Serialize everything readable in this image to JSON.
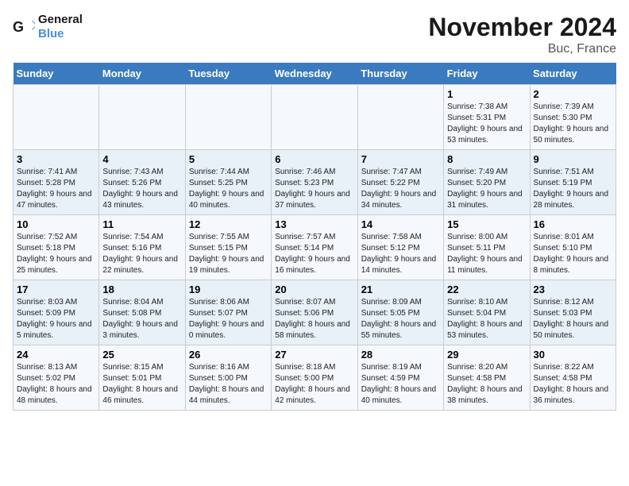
{
  "logo": {
    "text_general": "General",
    "text_blue": "Blue"
  },
  "header": {
    "month": "November 2024",
    "location": "Buc, France"
  },
  "days_of_week": [
    "Sunday",
    "Monday",
    "Tuesday",
    "Wednesday",
    "Thursday",
    "Friday",
    "Saturday"
  ],
  "weeks": [
    [
      {
        "day": "",
        "detail": ""
      },
      {
        "day": "",
        "detail": ""
      },
      {
        "day": "",
        "detail": ""
      },
      {
        "day": "",
        "detail": ""
      },
      {
        "day": "",
        "detail": ""
      },
      {
        "day": "1",
        "detail": "Sunrise: 7:38 AM\nSunset: 5:31 PM\nDaylight: 9 hours and 53 minutes."
      },
      {
        "day": "2",
        "detail": "Sunrise: 7:39 AM\nSunset: 5:30 PM\nDaylight: 9 hours and 50 minutes."
      }
    ],
    [
      {
        "day": "3",
        "detail": "Sunrise: 7:41 AM\nSunset: 5:28 PM\nDaylight: 9 hours and 47 minutes."
      },
      {
        "day": "4",
        "detail": "Sunrise: 7:43 AM\nSunset: 5:26 PM\nDaylight: 9 hours and 43 minutes."
      },
      {
        "day": "5",
        "detail": "Sunrise: 7:44 AM\nSunset: 5:25 PM\nDaylight: 9 hours and 40 minutes."
      },
      {
        "day": "6",
        "detail": "Sunrise: 7:46 AM\nSunset: 5:23 PM\nDaylight: 9 hours and 37 minutes."
      },
      {
        "day": "7",
        "detail": "Sunrise: 7:47 AM\nSunset: 5:22 PM\nDaylight: 9 hours and 34 minutes."
      },
      {
        "day": "8",
        "detail": "Sunrise: 7:49 AM\nSunset: 5:20 PM\nDaylight: 9 hours and 31 minutes."
      },
      {
        "day": "9",
        "detail": "Sunrise: 7:51 AM\nSunset: 5:19 PM\nDaylight: 9 hours and 28 minutes."
      }
    ],
    [
      {
        "day": "10",
        "detail": "Sunrise: 7:52 AM\nSunset: 5:18 PM\nDaylight: 9 hours and 25 minutes."
      },
      {
        "day": "11",
        "detail": "Sunrise: 7:54 AM\nSunset: 5:16 PM\nDaylight: 9 hours and 22 minutes."
      },
      {
        "day": "12",
        "detail": "Sunrise: 7:55 AM\nSunset: 5:15 PM\nDaylight: 9 hours and 19 minutes."
      },
      {
        "day": "13",
        "detail": "Sunrise: 7:57 AM\nSunset: 5:14 PM\nDaylight: 9 hours and 16 minutes."
      },
      {
        "day": "14",
        "detail": "Sunrise: 7:58 AM\nSunset: 5:12 PM\nDaylight: 9 hours and 14 minutes."
      },
      {
        "day": "15",
        "detail": "Sunrise: 8:00 AM\nSunset: 5:11 PM\nDaylight: 9 hours and 11 minutes."
      },
      {
        "day": "16",
        "detail": "Sunrise: 8:01 AM\nSunset: 5:10 PM\nDaylight: 9 hours and 8 minutes."
      }
    ],
    [
      {
        "day": "17",
        "detail": "Sunrise: 8:03 AM\nSunset: 5:09 PM\nDaylight: 9 hours and 5 minutes."
      },
      {
        "day": "18",
        "detail": "Sunrise: 8:04 AM\nSunset: 5:08 PM\nDaylight: 9 hours and 3 minutes."
      },
      {
        "day": "19",
        "detail": "Sunrise: 8:06 AM\nSunset: 5:07 PM\nDaylight: 9 hours and 0 minutes."
      },
      {
        "day": "20",
        "detail": "Sunrise: 8:07 AM\nSunset: 5:06 PM\nDaylight: 8 hours and 58 minutes."
      },
      {
        "day": "21",
        "detail": "Sunrise: 8:09 AM\nSunset: 5:05 PM\nDaylight: 8 hours and 55 minutes."
      },
      {
        "day": "22",
        "detail": "Sunrise: 8:10 AM\nSunset: 5:04 PM\nDaylight: 8 hours and 53 minutes."
      },
      {
        "day": "23",
        "detail": "Sunrise: 8:12 AM\nSunset: 5:03 PM\nDaylight: 8 hours and 50 minutes."
      }
    ],
    [
      {
        "day": "24",
        "detail": "Sunrise: 8:13 AM\nSunset: 5:02 PM\nDaylight: 8 hours and 48 minutes."
      },
      {
        "day": "25",
        "detail": "Sunrise: 8:15 AM\nSunset: 5:01 PM\nDaylight: 8 hours and 46 minutes."
      },
      {
        "day": "26",
        "detail": "Sunrise: 8:16 AM\nSunset: 5:00 PM\nDaylight: 8 hours and 44 minutes."
      },
      {
        "day": "27",
        "detail": "Sunrise: 8:18 AM\nSunset: 5:00 PM\nDaylight: 8 hours and 42 minutes."
      },
      {
        "day": "28",
        "detail": "Sunrise: 8:19 AM\nSunset: 4:59 PM\nDaylight: 8 hours and 40 minutes."
      },
      {
        "day": "29",
        "detail": "Sunrise: 8:20 AM\nSunset: 4:58 PM\nDaylight: 8 hours and 38 minutes."
      },
      {
        "day": "30",
        "detail": "Sunrise: 8:22 AM\nSunset: 4:58 PM\nDaylight: 8 hours and 36 minutes."
      }
    ]
  ]
}
